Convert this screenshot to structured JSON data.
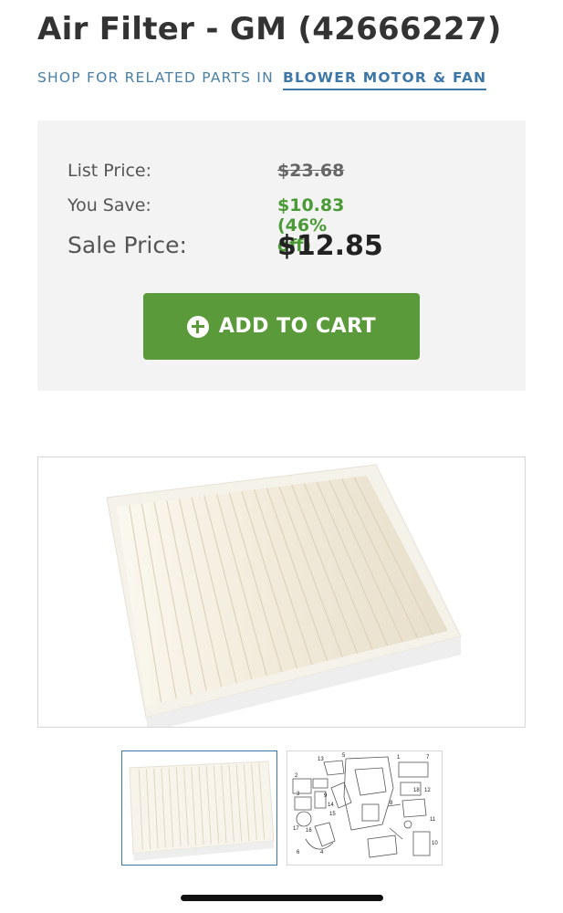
{
  "product": {
    "title": "Air Filter - GM (42666227)"
  },
  "related": {
    "prefix": "SHOP FOR RELATED PARTS IN",
    "link": "BLOWER MOTOR & FAN"
  },
  "pricing": {
    "list_label": "List Price:",
    "list_value": "$23.68",
    "save_label": "You Save:",
    "save_value": "$10.83 (46% off)",
    "sale_label": "Sale Price:",
    "sale_value": "$12.85"
  },
  "cart": {
    "label": "ADD TO CART",
    "icon": "plus-circle-icon"
  },
  "images": {
    "main": "air-filter-photo",
    "thumbnails": [
      "air-filter-thumbnail",
      "parts-diagram-thumbnail"
    ]
  },
  "colors": {
    "accent_green": "#5b9a3a",
    "savings_green": "#4a9a35",
    "link_blue": "#3d77a8"
  },
  "diagram": {
    "callouts": [
      "13",
      "1",
      "7",
      "2",
      "5",
      "11",
      "3",
      "10",
      "17",
      "16",
      "18",
      "12",
      "9",
      "4",
      "6",
      "8",
      "14",
      "15"
    ]
  }
}
